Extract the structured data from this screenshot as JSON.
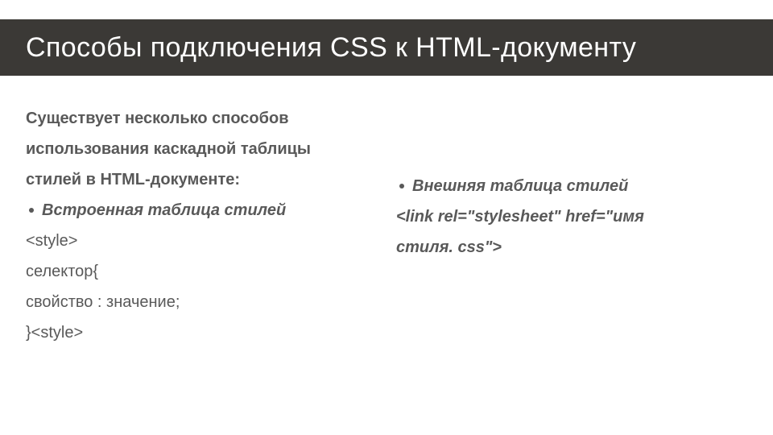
{
  "title": "Способы подключения CSS к HTML-документу",
  "left": {
    "intro_l1": "Существует несколько способов",
    "intro_l2": "использования каскадной таблицы",
    "intro_l3": "стилей в HTML-документе:",
    "bullet1": "Встроенная таблица стилей",
    "code1": "<style>",
    "code2": "селектор{",
    "code3": "свойство : значение;",
    "code4": "}<style>"
  },
  "right": {
    "bullet1": "Внешняя таблица стилей",
    "link_l1": "<link rel=\"stylesheet\" href=\"имя",
    "link_l2": "стиля. css\">"
  }
}
